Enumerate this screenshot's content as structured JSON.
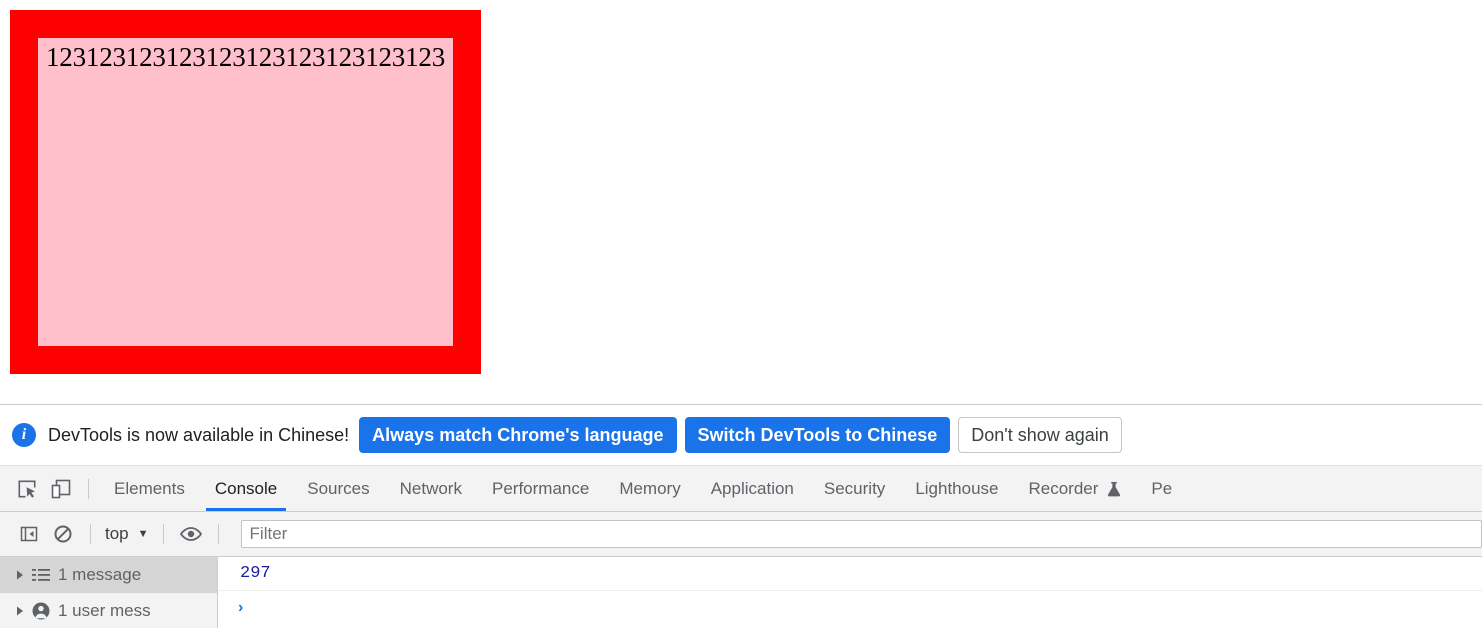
{
  "page": {
    "box": {
      "text": "123123123123123123123123123123",
      "border_color": "#ff0000",
      "fill_color": "#ffc0cb"
    }
  },
  "infobar": {
    "icon": "info-icon",
    "message": "DevTools is now available in Chinese!",
    "buttons": [
      {
        "label": "Always match Chrome's language",
        "style": "primary"
      },
      {
        "label": "Switch DevTools to Chinese",
        "style": "primary"
      },
      {
        "label": "Don't show again",
        "style": "secondary"
      }
    ],
    "accent_color": "#1a73e8"
  },
  "toolbar": {
    "inspect_icon": "inspect-element-icon",
    "device_icon": "device-toolbar-icon"
  },
  "tabs": [
    {
      "label": "Elements",
      "active": false
    },
    {
      "label": "Console",
      "active": true
    },
    {
      "label": "Sources",
      "active": false
    },
    {
      "label": "Network",
      "active": false
    },
    {
      "label": "Performance",
      "active": false
    },
    {
      "label": "Memory",
      "active": false
    },
    {
      "label": "Application",
      "active": false
    },
    {
      "label": "Security",
      "active": false
    },
    {
      "label": "Lighthouse",
      "active": false
    },
    {
      "label": "Recorder",
      "active": false,
      "experimental": true
    },
    {
      "label": "Pe",
      "active": false
    }
  ],
  "console_toolbar": {
    "sidebar_toggle_icon": "console-sidebar-toggle-icon",
    "clear_icon": "clear-console-icon",
    "context": "top",
    "context_caret": "▼",
    "eye_icon": "live-expression-eye-icon",
    "filter_placeholder": "Filter",
    "filter_value": ""
  },
  "console_sidebar": [
    {
      "label": "1 message",
      "icon": "list-icon",
      "selected": true
    },
    {
      "label": "1 user mess",
      "icon": "user-icon",
      "selected": false
    }
  ],
  "console_output": {
    "messages": [
      {
        "value": "297",
        "type": "number",
        "color": "#1a1aa6"
      }
    ],
    "prompt_symbol": "›"
  }
}
